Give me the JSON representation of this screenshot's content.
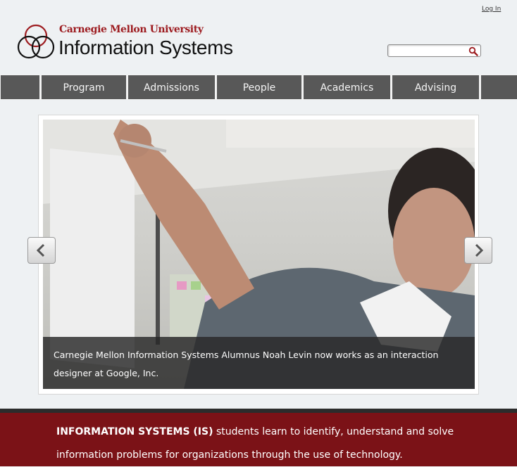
{
  "header": {
    "login_label": "Log In",
    "university": "Carnegie Mellon University",
    "department": "Information Systems",
    "search": {
      "value": "",
      "placeholder": ""
    }
  },
  "nav": {
    "items": [
      {
        "label": ""
      },
      {
        "label": "Program"
      },
      {
        "label": "Admissions"
      },
      {
        "label": "People"
      },
      {
        "label": "Academics"
      },
      {
        "label": "Advising"
      },
      {
        "label": ""
      }
    ]
  },
  "slider": {
    "caption": "Carnegie Mellon Information Systems Alumnus Noah Levin now works as an interaction designer at Google, Inc.",
    "prev_icon": "chevron-left-icon",
    "next_icon": "chevron-right-icon"
  },
  "tagline": {
    "emphasis": "INFORMATION SYSTEMS (IS)",
    "text": " students learn to identify, understand and solve information problems for organizations through the use of technology."
  },
  "colors": {
    "brand_red": "#9d1c20",
    "nav_bg": "#585858",
    "tagline_bg": "#7b1217"
  }
}
